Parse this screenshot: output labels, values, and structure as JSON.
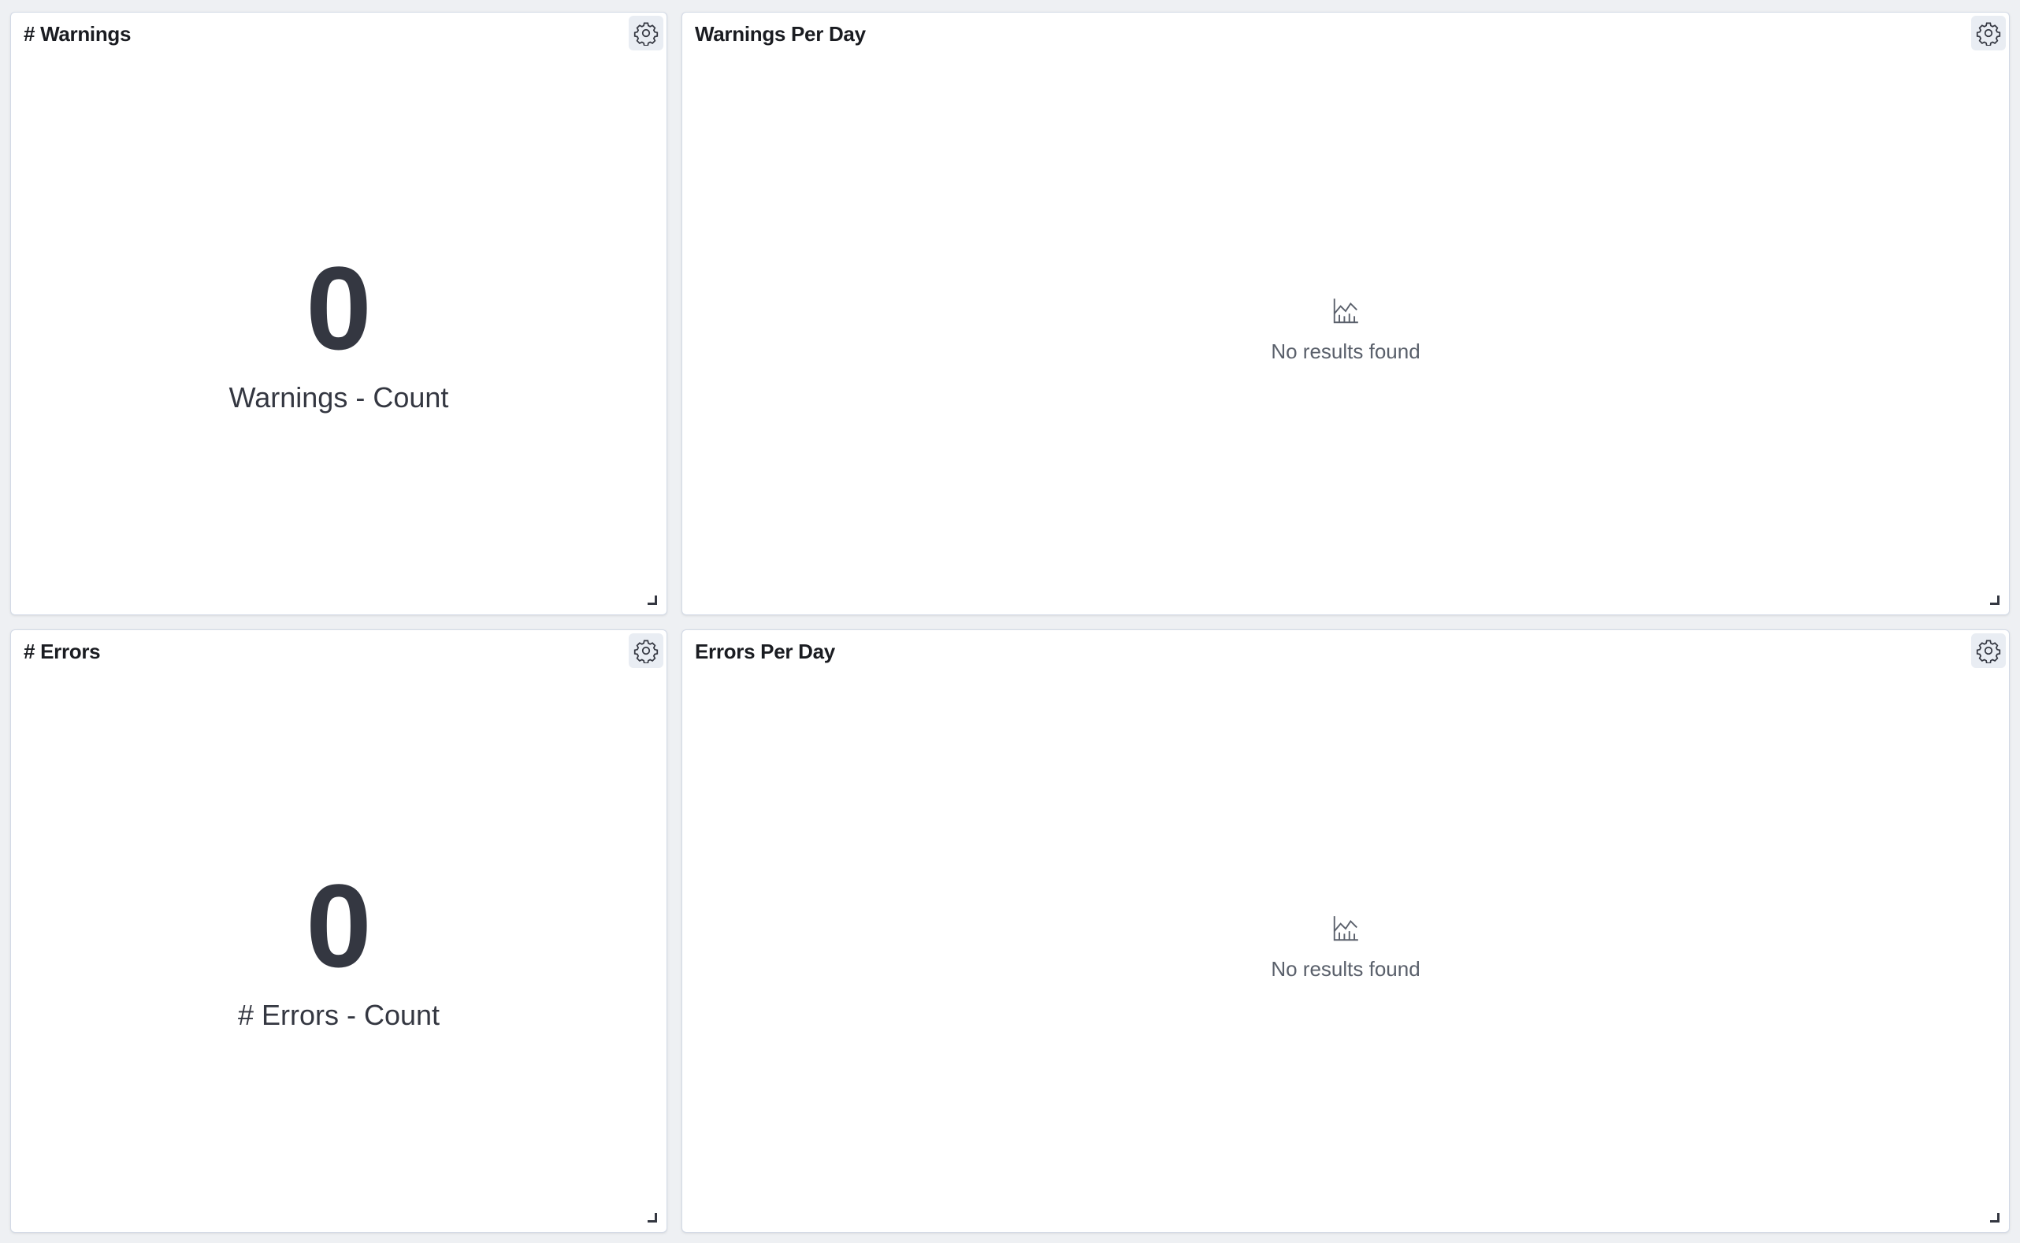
{
  "panels": {
    "warnings": {
      "title": "# Warnings",
      "value": "0",
      "label": "Warnings - Count"
    },
    "warnings_per_day": {
      "title": "Warnings Per Day",
      "empty_text": "No results found",
      "icon": "chart-icon"
    },
    "errors": {
      "title": "# Errors",
      "value": "0",
      "label": "# Errors - Count"
    },
    "errors_per_day": {
      "title": "Errors Per Day",
      "empty_text": "No results found",
      "icon": "chart-icon"
    }
  },
  "icons": {
    "settings": "gear-icon",
    "resize": "resize-handle-icon"
  },
  "colors": {
    "background": "#eef0f3",
    "panel": "#ffffff",
    "text": "#343741",
    "muted": "#5a606b"
  }
}
